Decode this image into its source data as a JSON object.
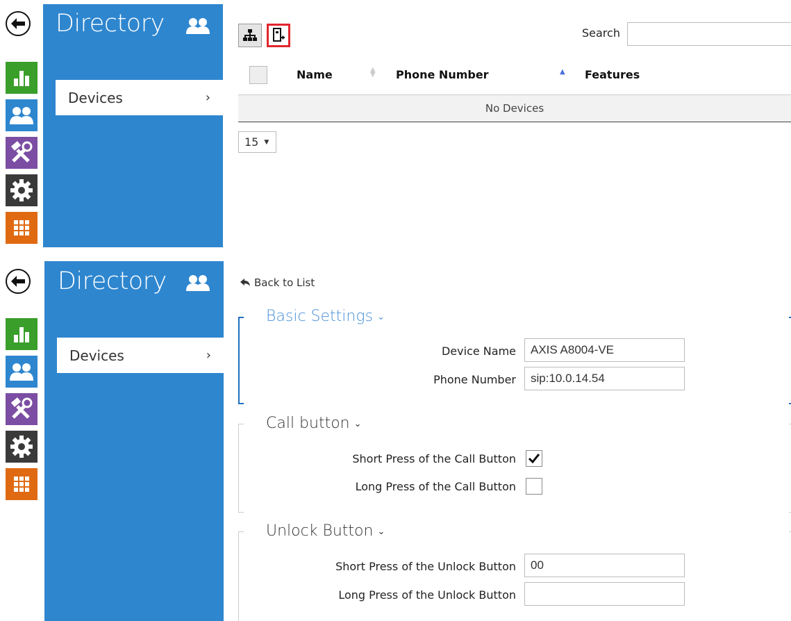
{
  "panels": [
    {
      "sidebar": {
        "title": "Directory",
        "items": [
          {
            "label": "Devices",
            "chevron": "›"
          }
        ]
      },
      "rail": [
        "back-arrow-icon",
        "status-chart-icon",
        "directory-users-icon",
        "hardware-tools-icon",
        "settings-gear-icon",
        "services-grid-icon"
      ],
      "toolbar": {
        "highlighted": "add-device-icon"
      },
      "search": {
        "label": "Search",
        "value": ""
      },
      "table": {
        "columns": [
          "Name",
          "Phone Number",
          "Features"
        ],
        "empty_text": "No Devices"
      },
      "page_size": "15"
    },
    {
      "sidebar": {
        "title": "Directory",
        "items": [
          {
            "label": "Devices",
            "chevron": "›"
          }
        ]
      },
      "back_link": "Back to List",
      "sections": [
        {
          "title": "Basic Settings",
          "fields": [
            {
              "label": "Device Name",
              "value": "AXIS A8004-VE"
            },
            {
              "label": "Phone Number",
              "value": "sip:10.0.14.54"
            }
          ]
        },
        {
          "title": "Call button",
          "fields": [
            {
              "label": "Short Press of the Call Button",
              "checked": true
            },
            {
              "label": "Long Press of the Call Button",
              "checked": false
            }
          ]
        },
        {
          "title": "Unlock Button",
          "fields": [
            {
              "label": "Short Press of the Unlock Button",
              "value": "00"
            },
            {
              "label": "Long Press of the Unlock Button",
              "value": ""
            }
          ]
        }
      ]
    }
  ],
  "colors": {
    "sidebar_blue": "#2e86cf",
    "chart_green": "#3a9e2a",
    "users_blue": "#2e86cf",
    "tools_purple": "#7b4ea3",
    "gear_dark": "#3a3a3a",
    "grid_orange": "#e06a12",
    "highlight_red": "#e0262d"
  }
}
